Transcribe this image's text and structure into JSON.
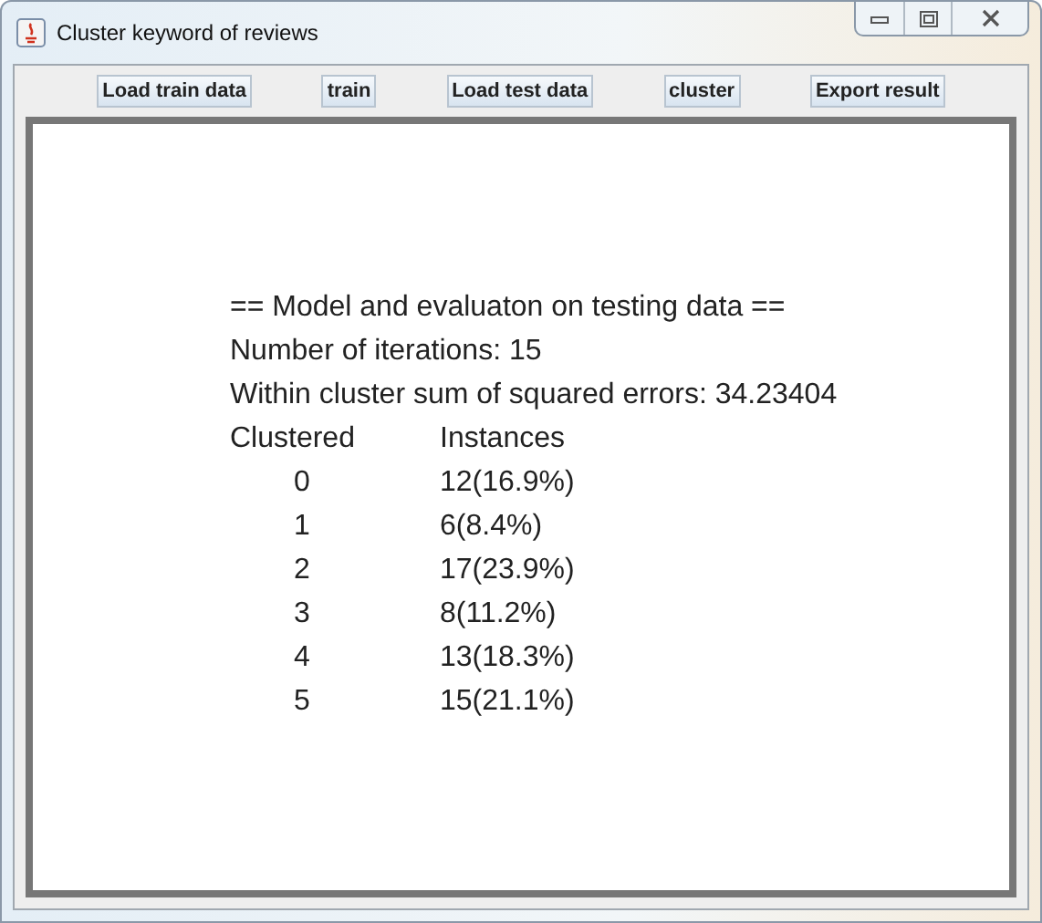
{
  "window": {
    "title": "Cluster keyword of reviews"
  },
  "buttons": [
    "Load train data",
    "train",
    "Load test data",
    "cluster",
    "Export result"
  ],
  "output": {
    "heading": "== Model and evaluaton on testing data ==",
    "iterations": "Number of iterations: 15",
    "sse": "Within cluster sum of squared errors: 34.23404",
    "columns": [
      "Clustered",
      "Instances"
    ],
    "rows": [
      {
        "cluster": "0",
        "instances": "12(16.9%)"
      },
      {
        "cluster": "1",
        "instances": "6(8.4%)"
      },
      {
        "cluster": "2",
        "instances": "17(23.9%)"
      },
      {
        "cluster": "3",
        "instances": "8(11.2%)"
      },
      {
        "cluster": "4",
        "instances": "13(18.3%)"
      },
      {
        "cluster": "5",
        "instances": "15(21.1%)"
      }
    ]
  }
}
